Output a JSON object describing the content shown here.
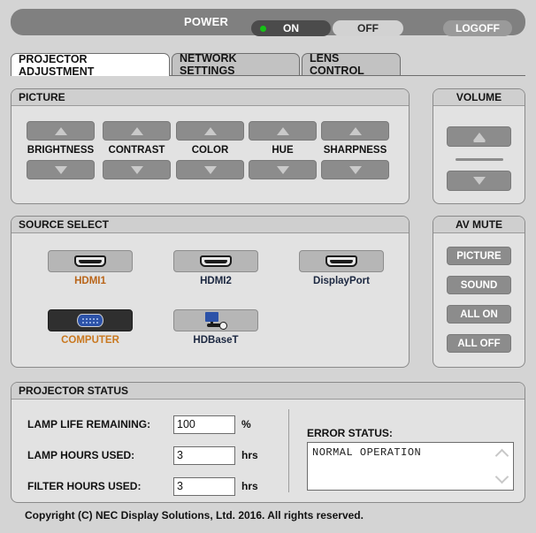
{
  "power": {
    "label": "POWER",
    "on_label": "ON",
    "off_label": "OFF",
    "logoff_label": "LOGOFF",
    "state": "ON",
    "led_color": "#16c216",
    "bar_color": "#808080"
  },
  "tabs": [
    {
      "label": "PROJECTOR ADJUSTMENT",
      "active": true
    },
    {
      "label": "NETWORK SETTINGS",
      "active": false
    },
    {
      "label": "LENS CONTROL",
      "active": false
    }
  ],
  "picture": {
    "title": "PICTURE",
    "controls": [
      {
        "label": "BRIGHTNESS"
      },
      {
        "label": "CONTRAST"
      },
      {
        "label": "COLOR"
      },
      {
        "label": "HUE"
      },
      {
        "label": "SHARPNESS"
      }
    ]
  },
  "volume": {
    "title": "VOLUME"
  },
  "source_select": {
    "title": "SOURCE SELECT",
    "items": [
      {
        "label": "HDMI1",
        "icon": "hdmi-port-icon",
        "selected": false,
        "label_color": "#b9651a"
      },
      {
        "label": "HDMI2",
        "icon": "hdmi-port-icon",
        "selected": false,
        "label_color": "#1b2740"
      },
      {
        "label": "DisplayPort",
        "icon": "hdmi-port-icon",
        "selected": false,
        "label_color": "#1b2740"
      },
      {
        "label": "COMPUTER",
        "icon": "vga-port-icon",
        "selected": true,
        "label_color": "#c9781f"
      },
      {
        "label": "HDBaseT",
        "icon": "hdbaset-port-icon",
        "selected": false,
        "label_color": "#1b2740"
      }
    ]
  },
  "av_mute": {
    "title": "AV MUTE",
    "buttons": [
      {
        "label": "PICTURE"
      },
      {
        "label": "SOUND"
      },
      {
        "label": "ALL ON"
      },
      {
        "label": "ALL OFF"
      }
    ]
  },
  "projector_status": {
    "title": "PROJECTOR STATUS",
    "rows": [
      {
        "label": "LAMP LIFE REMAINING:",
        "value": "100",
        "unit": "%"
      },
      {
        "label": "LAMP HOURS USED:",
        "value": "3",
        "unit": "hrs"
      },
      {
        "label": "FILTER HOURS USED:",
        "value": "3",
        "unit": "hrs"
      }
    ],
    "error_status_title": "ERROR STATUS:",
    "error_status_text": "NORMAL OPERATION"
  },
  "footer": {
    "copyright": "Copyright (C) NEC Display Solutions, Ltd. 2016. All rights reserved."
  }
}
